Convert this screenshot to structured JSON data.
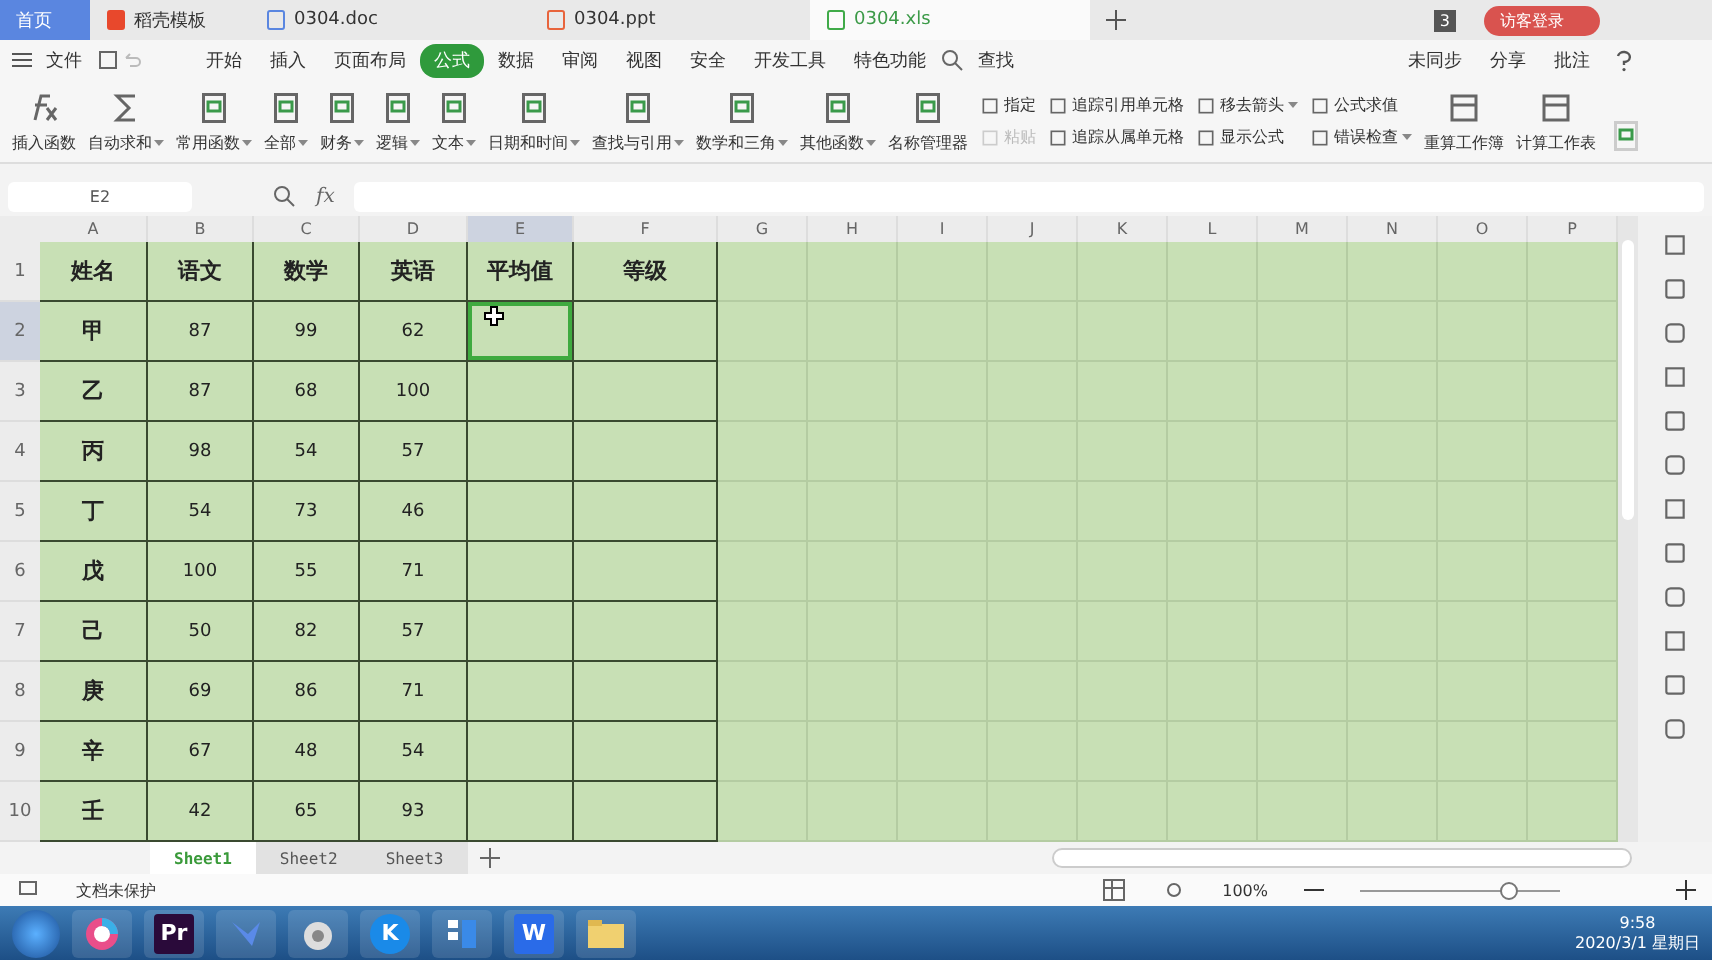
{
  "tabs": [
    {
      "label": "首页",
      "kind": "home",
      "selected": false
    },
    {
      "label": "稻壳模板",
      "kind": "docer",
      "selected": false
    },
    {
      "label": "0304.doc",
      "kind": "doc",
      "selected": false
    },
    {
      "label": "0304.ppt",
      "kind": "ppt",
      "selected": false
    },
    {
      "label": "0304.xls",
      "kind": "xls",
      "selected": true
    }
  ],
  "tab_badge": "3",
  "login_button": "访客登录",
  "menu": {
    "file": "文件",
    "items": [
      {
        "label": "开始",
        "selected": false
      },
      {
        "label": "插入",
        "selected": false
      },
      {
        "label": "页面布局",
        "selected": false
      },
      {
        "label": "公式",
        "selected": true
      },
      {
        "label": "数据",
        "selected": false
      },
      {
        "label": "审阅",
        "selected": false
      },
      {
        "label": "视图",
        "selected": false
      },
      {
        "label": "安全",
        "selected": false
      },
      {
        "label": "开发工具",
        "selected": false
      },
      {
        "label": "特色功能",
        "selected": false
      }
    ],
    "search": "查找",
    "right": [
      "未同步",
      "分享",
      "批注"
    ]
  },
  "ribbon": {
    "big": [
      {
        "label": "插入函数",
        "kind": "fx",
        "dropdown": false
      },
      {
        "label": "自动求和",
        "kind": "sigma",
        "dropdown": true
      },
      {
        "label": "常用函数",
        "kind": "book",
        "dropdown": true
      },
      {
        "label": "全部",
        "kind": "book",
        "dropdown": true
      },
      {
        "label": "财务",
        "kind": "book",
        "dropdown": true
      },
      {
        "label": "逻辑",
        "kind": "book",
        "dropdown": true
      },
      {
        "label": "文本",
        "kind": "book",
        "dropdown": true
      },
      {
        "label": "日期和时间",
        "kind": "book",
        "dropdown": true
      },
      {
        "label": "查找与引用",
        "kind": "book",
        "dropdown": true
      },
      {
        "label": "数学和三角",
        "kind": "book",
        "dropdown": true
      },
      {
        "label": "其他函数",
        "kind": "book",
        "dropdown": true
      },
      {
        "label": "名称管理器",
        "kind": "book",
        "dropdown": false
      }
    ],
    "small": [
      {
        "label": "指定",
        "disabled": false,
        "dropdown": false
      },
      {
        "label": "粘贴",
        "disabled": true,
        "dropdown": false
      },
      {
        "label": "追踪引用单元格",
        "disabled": false,
        "dropdown": false
      },
      {
        "label": "追踪从属单元格",
        "disabled": false,
        "dropdown": false
      },
      {
        "label": "移去箭头",
        "disabled": false,
        "dropdown": true
      },
      {
        "label": "显示公式",
        "disabled": false,
        "dropdown": false
      },
      {
        "label": "公式求值",
        "disabled": false,
        "dropdown": false
      },
      {
        "label": "错误检查",
        "disabled": false,
        "dropdown": true
      }
    ],
    "right": [
      {
        "label": "重算工作簿"
      },
      {
        "label": "计算工作表"
      }
    ]
  },
  "name_box": "E2",
  "formula_label": "fx",
  "grid": {
    "columns": [
      {
        "label": "A",
        "selected": false
      },
      {
        "label": "B",
        "selected": false
      },
      {
        "label": "C",
        "selected": false
      },
      {
        "label": "D",
        "selected": false
      },
      {
        "label": "E",
        "selected": true
      },
      {
        "label": "F",
        "selected": false
      },
      {
        "label": "G",
        "selected": false
      },
      {
        "label": "H",
        "selected": false
      },
      {
        "label": "I",
        "selected": false
      },
      {
        "label": "J",
        "selected": false
      },
      {
        "label": "K",
        "selected": false
      },
      {
        "label": "L",
        "selected": false
      },
      {
        "label": "M",
        "selected": false
      },
      {
        "label": "N",
        "selected": false
      },
      {
        "label": "O",
        "selected": false
      },
      {
        "label": "P",
        "selected": false
      }
    ],
    "rows": [
      {
        "number": "1",
        "selected": false,
        "header": true,
        "cells": [
          {
            "text": "姓名",
            "selected": false
          },
          {
            "text": "语文",
            "selected": false
          },
          {
            "text": "数学",
            "selected": false
          },
          {
            "text": "英语",
            "selected": false
          },
          {
            "text": "平均值",
            "selected": false
          },
          {
            "text": "等级",
            "selected": false
          }
        ]
      },
      {
        "number": "2",
        "selected": true,
        "header": false,
        "cells": [
          {
            "text": "甲",
            "selected": false
          },
          {
            "text": "87",
            "selected": false
          },
          {
            "text": "99",
            "selected": false
          },
          {
            "text": "62",
            "selected": false
          },
          {
            "selected": true
          },
          {
            "selected": false
          }
        ]
      },
      {
        "number": "3",
        "selected": false,
        "header": false,
        "cells": [
          {
            "text": "乙",
            "selected": false
          },
          {
            "text": "87",
            "selected": false
          },
          {
            "text": "68",
            "selected": false
          },
          {
            "text": "100",
            "selected": false
          },
          {
            "selected": false
          },
          {
            "selected": false
          }
        ]
      },
      {
        "number": "4",
        "selected": false,
        "header": false,
        "cells": [
          {
            "text": "丙",
            "selected": false
          },
          {
            "text": "98",
            "selected": false
          },
          {
            "text": "54",
            "selected": false
          },
          {
            "text": "57",
            "selected": false
          },
          {
            "selected": false
          },
          {
            "selected": false
          }
        ]
      },
      {
        "number": "5",
        "selected": false,
        "header": false,
        "cells": [
          {
            "text": "丁",
            "selected": false
          },
          {
            "text": "54",
            "selected": false
          },
          {
            "text": "73",
            "selected": false
          },
          {
            "text": "46",
            "selected": false
          },
          {
            "selected": false
          },
          {
            "selected": false
          }
        ]
      },
      {
        "number": "6",
        "selected": false,
        "header": false,
        "cells": [
          {
            "text": "戊",
            "selected": false
          },
          {
            "text": "100",
            "selected": false
          },
          {
            "text": "55",
            "selected": false
          },
          {
            "text": "71",
            "selected": false
          },
          {
            "selected": false
          },
          {
            "selected": false
          }
        ]
      },
      {
        "number": "7",
        "selected": false,
        "header": false,
        "cells": [
          {
            "text": "己",
            "selected": false
          },
          {
            "text": "50",
            "selected": false
          },
          {
            "text": "82",
            "selected": false
          },
          {
            "text": "57",
            "selected": false
          },
          {
            "selected": false
          },
          {
            "selected": false
          }
        ]
      },
      {
        "number": "8",
        "selected": false,
        "header": false,
        "cells": [
          {
            "text": "庚",
            "selected": false
          },
          {
            "text": "69",
            "selected": false
          },
          {
            "text": "86",
            "selected": false
          },
          {
            "text": "71",
            "selected": false
          },
          {
            "selected": false
          },
          {
            "selected": false
          }
        ]
      },
      {
        "number": "9",
        "selected": false,
        "header": false,
        "cells": [
          {
            "text": "辛",
            "selected": false
          },
          {
            "text": "67",
            "selected": false
          },
          {
            "text": "48",
            "selected": false
          },
          {
            "text": "54",
            "selected": false
          },
          {
            "selected": false
          },
          {
            "selected": false
          }
        ]
      },
      {
        "number": "10",
        "selected": false,
        "header": false,
        "cells": [
          {
            "text": "壬",
            "selected": false
          },
          {
            "text": "42",
            "selected": false
          },
          {
            "text": "65",
            "selected": false
          },
          {
            "text": "93",
            "selected": false
          },
          {
            "selected": false
          },
          {
            "selected": false
          }
        ]
      }
    ]
  },
  "sheets": [
    {
      "label": "Sheet1",
      "selected": true
    },
    {
      "label": "Sheet2",
      "selected": false
    },
    {
      "label": "Sheet3",
      "selected": false
    }
  ],
  "status": {
    "protection": "文档未保护",
    "zoom": "100%",
    "zoom_slider": {
      "level": 0.75
    }
  },
  "taskbar": {
    "apps": [
      {
        "kind": "browser"
      },
      {
        "kind": "text",
        "label": "Pr",
        "color": "#2a0a3a"
      },
      {
        "kind": "bird"
      },
      {
        "kind": "dog"
      },
      {
        "kind": "text",
        "label": "K",
        "color": "#1a8ae8"
      },
      {
        "kind": "blocks"
      },
      {
        "kind": "text",
        "label": "W",
        "color": "#2a6be8"
      },
      {
        "kind": "folder"
      }
    ],
    "time": "9:58",
    "date": "2020/3/1 星期日"
  }
}
